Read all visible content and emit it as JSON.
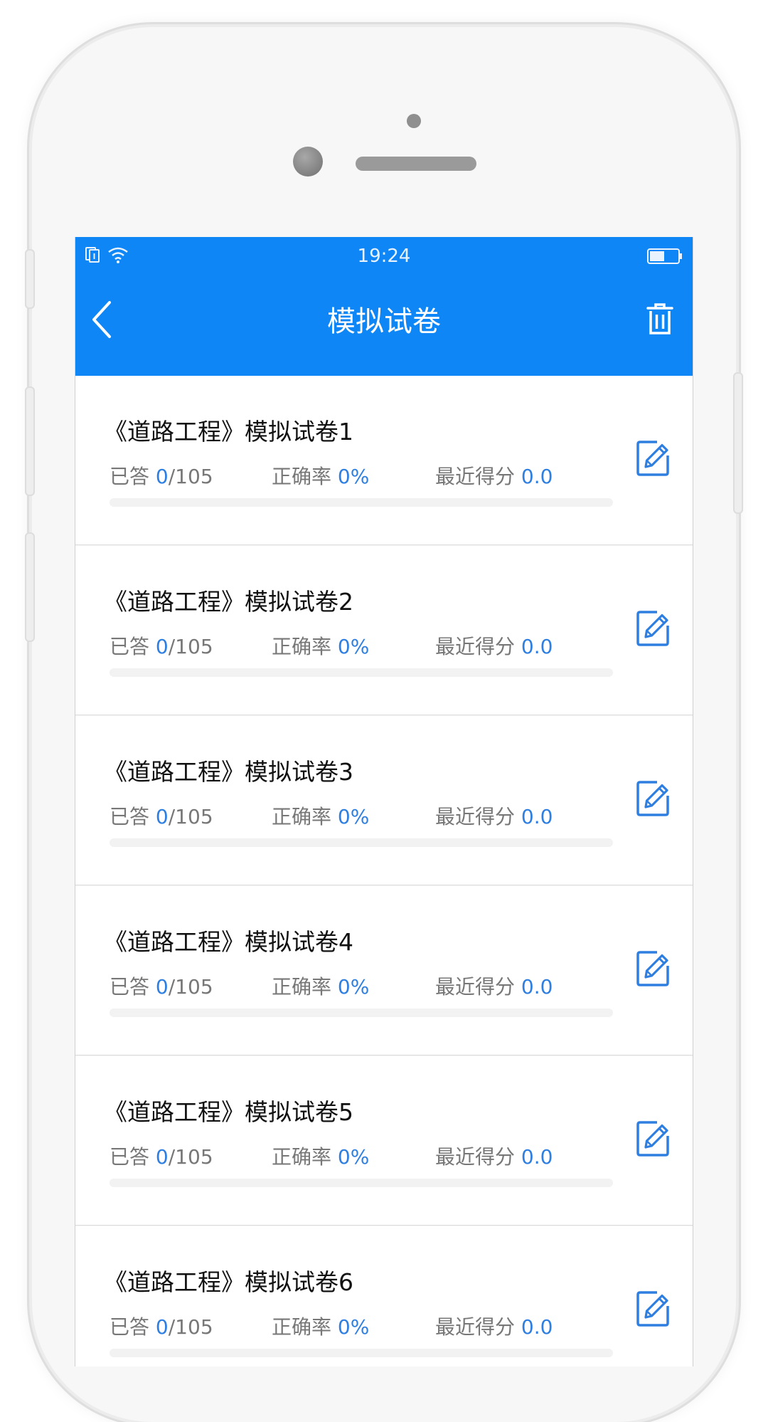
{
  "colors": {
    "accent": "#0f86f6",
    "value_blue": "#2f7fe0"
  },
  "status_bar": {
    "time": "19:24",
    "icons": [
      "sim-icon",
      "wifi-icon",
      "battery-icon"
    ]
  },
  "header": {
    "title": "模拟试卷",
    "back_icon": "chevron-left-icon",
    "delete_icon": "trash-icon"
  },
  "papers": [
    {
      "title": "《道路工程》模拟试卷1",
      "answered_label": "已答",
      "answered": "0",
      "total": "/105",
      "accuracy_label": "正确率",
      "accuracy": "0%",
      "score_label": "最近得分",
      "score": "0.0",
      "progress": 0
    },
    {
      "title": "《道路工程》模拟试卷2",
      "answered_label": "已答",
      "answered": "0",
      "total": "/105",
      "accuracy_label": "正确率",
      "accuracy": "0%",
      "score_label": "最近得分",
      "score": "0.0",
      "progress": 0
    },
    {
      "title": "《道路工程》模拟试卷3",
      "answered_label": "已答",
      "answered": "0",
      "total": "/105",
      "accuracy_label": "正确率",
      "accuracy": "0%",
      "score_label": "最近得分",
      "score": "0.0",
      "progress": 0
    },
    {
      "title": "《道路工程》模拟试卷4",
      "answered_label": "已答",
      "answered": "0",
      "total": "/105",
      "accuracy_label": "正确率",
      "accuracy": "0%",
      "score_label": "最近得分",
      "score": "0.0",
      "progress": 0
    },
    {
      "title": "《道路工程》模拟试卷5",
      "answered_label": "已答",
      "answered": "0",
      "total": "/105",
      "accuracy_label": "正确率",
      "accuracy": "0%",
      "score_label": "最近得分",
      "score": "0.0",
      "progress": 0
    },
    {
      "title": "《道路工程》模拟试卷6",
      "answered_label": "已答",
      "answered": "0",
      "total": "/105",
      "accuracy_label": "正确率",
      "accuracy": "0%",
      "score_label": "最近得分",
      "score": "0.0",
      "progress": 0
    }
  ]
}
